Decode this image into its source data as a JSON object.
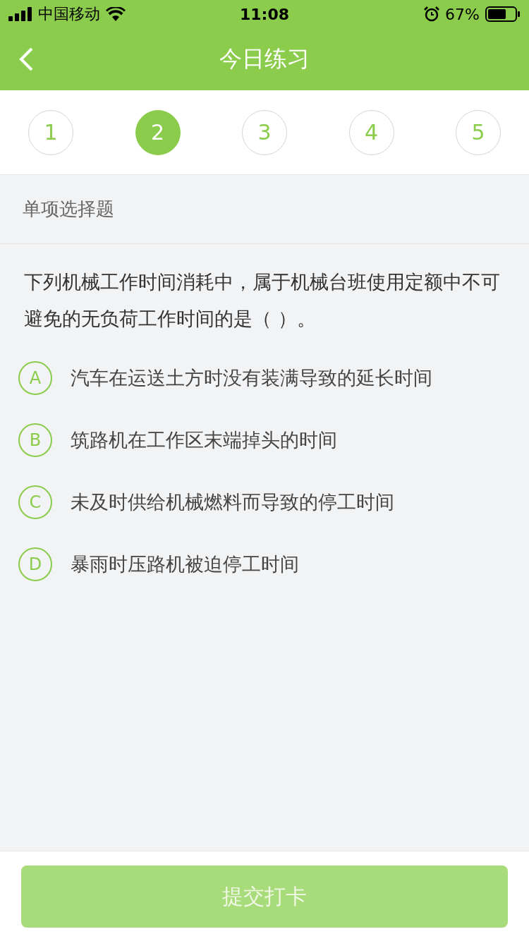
{
  "status_bar": {
    "carrier": "中国移动",
    "time": "11:08",
    "battery": "67%"
  },
  "nav": {
    "title": "今日练习"
  },
  "steps": [
    {
      "label": "1",
      "selected": false
    },
    {
      "label": "2",
      "selected": true
    },
    {
      "label": "3",
      "selected": false
    },
    {
      "label": "4",
      "selected": false
    },
    {
      "label": "5",
      "selected": false
    }
  ],
  "section": {
    "title": "单项选择题"
  },
  "question": "下列机械工作时间消耗中，属于机械台班使用定额中不可避免的无负荷工作时间的是（    ）。",
  "options": [
    {
      "letter": "A",
      "text": "汽车在运送土方时没有装满导致的延长时间",
      "selected": false
    },
    {
      "letter": "B",
      "text": "筑路机在工作区末端掉头的时间",
      "selected": false
    },
    {
      "letter": "C",
      "text": "未及时供给机械燃料而导致的停工时间",
      "selected": false
    },
    {
      "letter": "D",
      "text": "暴雨时压路机被迫停工时间",
      "selected": false
    }
  ],
  "submit": {
    "label": "提交打卡",
    "disabled": true
  }
}
